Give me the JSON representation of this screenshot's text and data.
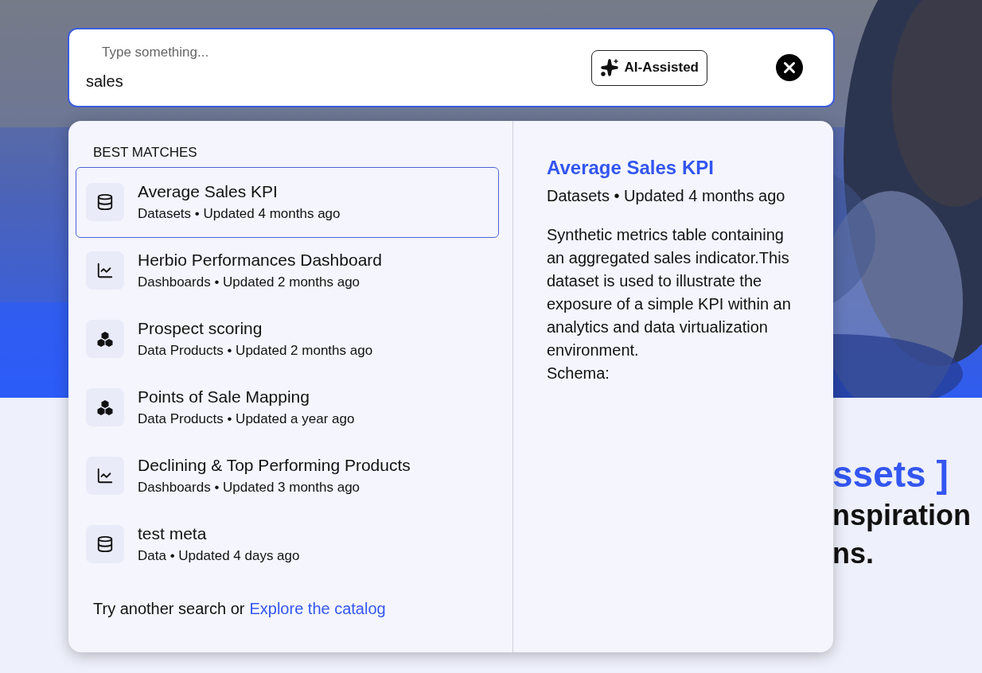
{
  "search": {
    "placeholder": "Type something...",
    "value": "sales",
    "ai_button": "AI-Assisted"
  },
  "results": {
    "heading": "BEST MATCHES",
    "items": [
      {
        "kind": "dataset",
        "title": "Average Sales KPI",
        "subtitle": "Datasets • Updated 4 months ago",
        "selected": true
      },
      {
        "kind": "dashboard",
        "title": "Herbio Performances Dashboard",
        "subtitle": "Dashboards • Updated 2 months ago",
        "selected": false
      },
      {
        "kind": "product",
        "title": "Prospect scoring",
        "subtitle": "Data Products • Updated 2 months ago",
        "selected": false
      },
      {
        "kind": "product",
        "title": "Points of Sale Mapping",
        "subtitle": "Data Products • Updated a year ago",
        "selected": false
      },
      {
        "kind": "dashboard",
        "title": "Declining & Top Performing Products",
        "subtitle": "Dashboards • Updated 3 months ago",
        "selected": false
      },
      {
        "kind": "dataset",
        "title": "test meta",
        "subtitle": "Data • Updated 4 days ago",
        "selected": false
      }
    ],
    "footer": {
      "text": "Try another search or",
      "link": "Explore the catalog"
    }
  },
  "preview": {
    "title": "Average Sales KPI",
    "meta": "Datasets • Updated 4 months ago",
    "description": "Synthetic metrics table containing an aggregated sales indicator.This dataset is used to illustrate the exposure of a simple KPI within an analytics and data virtualization environment.",
    "schema_label": "Schema:"
  },
  "hero": {
    "heading": "ssets ]",
    "lines": [
      "nspiration",
      "ns."
    ]
  }
}
